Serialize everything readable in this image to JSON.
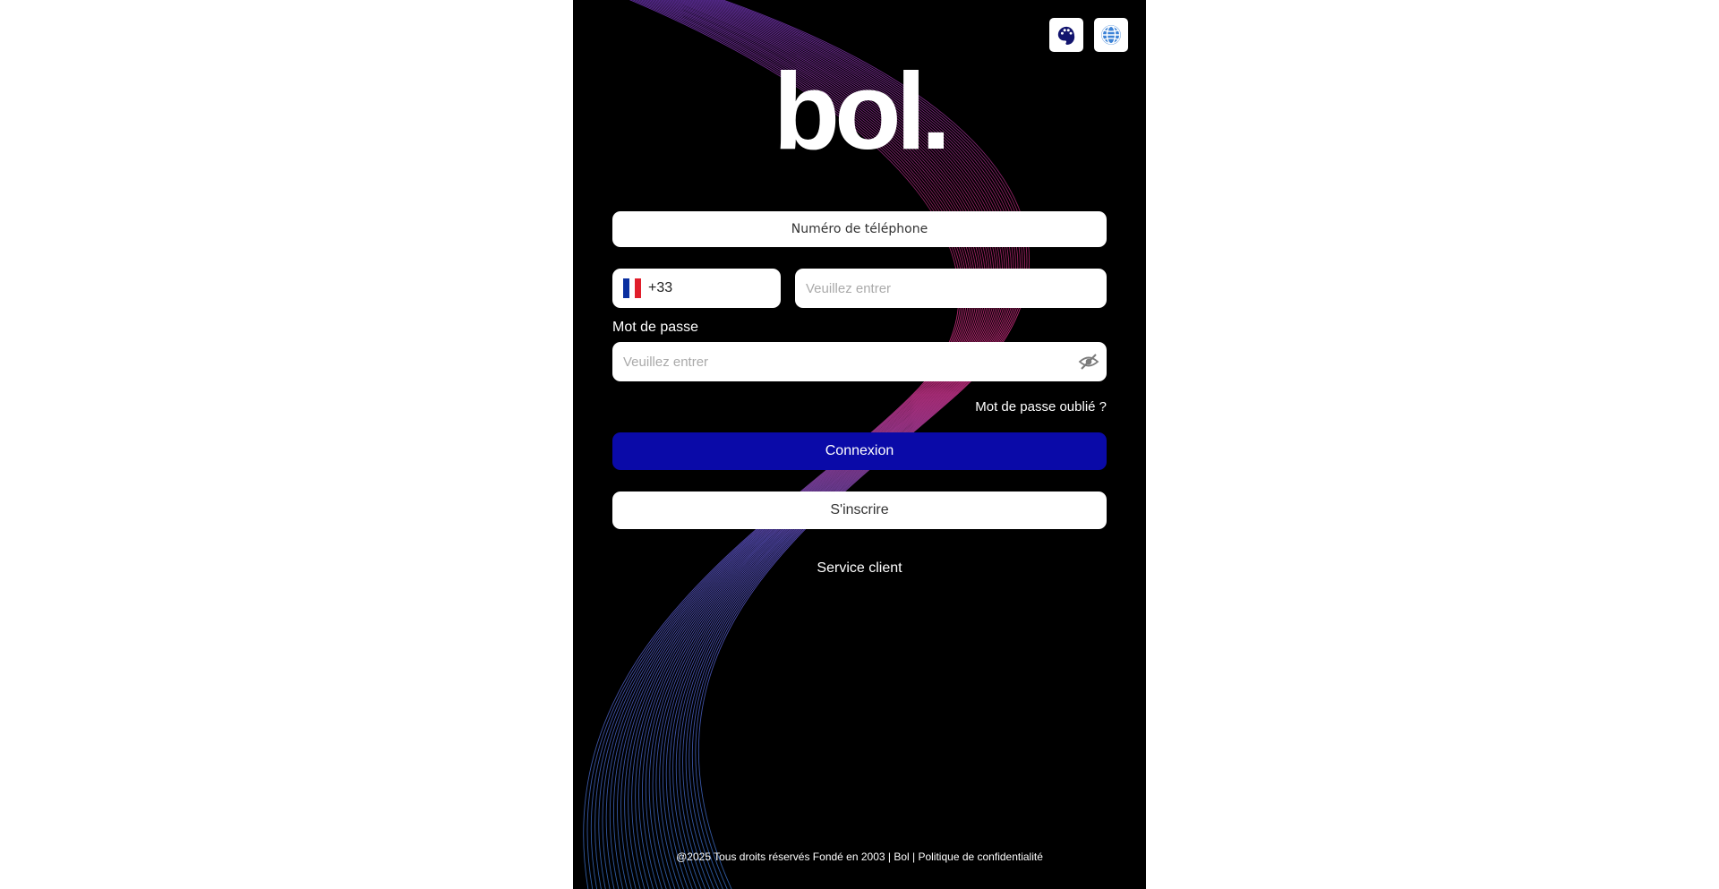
{
  "brand": {
    "logo_text": "bol."
  },
  "top_buttons": {
    "theme_icon": "palette-icon",
    "language_icon": "globe-icon"
  },
  "form": {
    "phone_label": "Numéro de téléphone",
    "country_code": "+33",
    "country_flag": "france-flag-icon",
    "phone_placeholder": "Veuillez entrer",
    "phone_value": "",
    "password_label": "Mot de passe",
    "password_placeholder": "Veuillez entrer",
    "password_value": "",
    "password_toggle_icon": "eye-off-icon",
    "forgot_password": "Mot de passe oublié ?",
    "login_button": "Connexion",
    "signup_button": "S'inscrire",
    "customer_service": "Service client"
  },
  "footer": {
    "text": "@2025 Tous droits réservés Fondé en 2003 | Bol | Politique de confidentialité"
  },
  "colors": {
    "background": "#000000",
    "primary_button": "#0a0aa8",
    "wave_pink": "#e0338f",
    "wave_blue": "#3a7bd5"
  }
}
